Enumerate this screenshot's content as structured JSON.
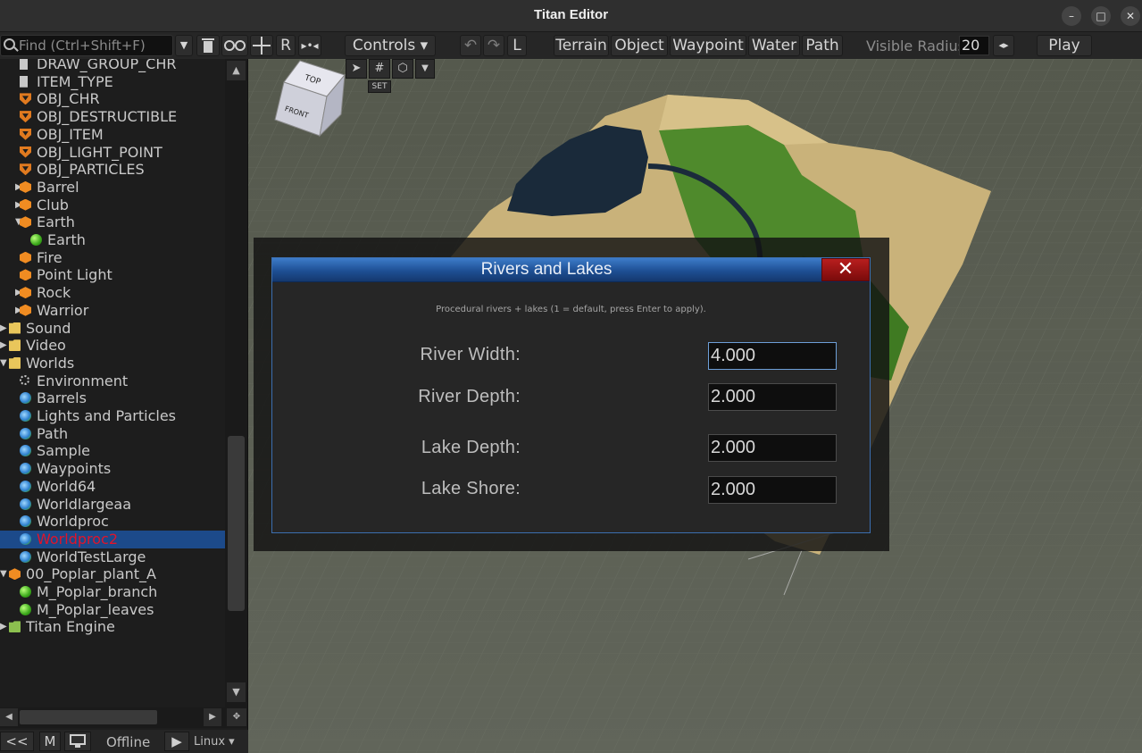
{
  "window": {
    "title": "Titan Editor"
  },
  "window_controls": {
    "minimize": "–",
    "maximize": "□",
    "close": "✕"
  },
  "toolbar": {
    "find_placeholder": "Find (Ctrl+Shift+F)",
    "r_label": "R",
    "controls_label": "Controls ▾",
    "l_label": "L",
    "modes": [
      "Terrain",
      "Object",
      "Waypoint",
      "Water",
      "Path"
    ],
    "visible_radius_label": "Visible Radius",
    "visible_radius_value": "20",
    "play_label": "Play"
  },
  "viewport": {
    "set_label": "SET",
    "view_cube": {
      "top": "TOP",
      "front": "FRONT"
    }
  },
  "tree": {
    "items": [
      {
        "label": "DRAW_GROUP_CHR",
        "icon": "doc-icon",
        "depth": 1,
        "arrow": ""
      },
      {
        "label": "ITEM_TYPE",
        "icon": "doc-icon",
        "depth": 1,
        "arrow": ""
      },
      {
        "label": "OBJ_CHR",
        "icon": "shield-icon",
        "depth": 1,
        "arrow": ""
      },
      {
        "label": "OBJ_DESTRUCTIBLE",
        "icon": "shield-icon",
        "depth": 1,
        "arrow": ""
      },
      {
        "label": "OBJ_ITEM",
        "icon": "shield-icon",
        "depth": 1,
        "arrow": ""
      },
      {
        "label": "OBJ_LIGHT_POINT",
        "icon": "shield-icon",
        "depth": 1,
        "arrow": ""
      },
      {
        "label": "OBJ_PARTICLES",
        "icon": "shield-icon",
        "depth": 1,
        "arrow": ""
      },
      {
        "label": "Barrel",
        "icon": "cube-icon",
        "depth": 1,
        "arrow": "▶"
      },
      {
        "label": "Club",
        "icon": "cube-icon",
        "depth": 1,
        "arrow": "▶"
      },
      {
        "label": "Earth",
        "icon": "cube-icon",
        "depth": 1,
        "arrow": "▼"
      },
      {
        "label": "Earth",
        "icon": "ball-icon",
        "depth": 2,
        "arrow": ""
      },
      {
        "label": "Fire",
        "icon": "cube-icon",
        "depth": 1,
        "arrow": ""
      },
      {
        "label": "Point Light",
        "icon": "cube-icon",
        "depth": 1,
        "arrow": ""
      },
      {
        "label": "Rock",
        "icon": "cube-icon",
        "depth": 1,
        "arrow": "▶"
      },
      {
        "label": "Warrior",
        "icon": "cube-icon",
        "depth": 1,
        "arrow": "▶"
      },
      {
        "label": "Sound",
        "icon": "folder-icon",
        "depth": 0,
        "arrow": "▶"
      },
      {
        "label": "Video",
        "icon": "folder-icon",
        "depth": 0,
        "arrow": "▶"
      },
      {
        "label": "Worlds",
        "icon": "folder-icon",
        "depth": 0,
        "arrow": "▼"
      },
      {
        "label": "Environment",
        "icon": "sun-icon",
        "depth": 1,
        "arrow": ""
      },
      {
        "label": "Barrels",
        "icon": "globe-icon",
        "depth": 1,
        "arrow": ""
      },
      {
        "label": "Lights and Particles",
        "icon": "globe-icon",
        "depth": 1,
        "arrow": ""
      },
      {
        "label": "Path",
        "icon": "globe-icon",
        "depth": 1,
        "arrow": ""
      },
      {
        "label": "Sample",
        "icon": "globe-icon",
        "depth": 1,
        "arrow": ""
      },
      {
        "label": "Waypoints",
        "icon": "globe-icon",
        "depth": 1,
        "arrow": ""
      },
      {
        "label": "World64",
        "icon": "globe-icon",
        "depth": 1,
        "arrow": ""
      },
      {
        "label": "Worldlargeaa",
        "icon": "globe-icon",
        "depth": 1,
        "arrow": ""
      },
      {
        "label": "Worldproc",
        "icon": "globe-icon",
        "depth": 1,
        "arrow": ""
      },
      {
        "label": "Worldproc2",
        "icon": "globe-icon",
        "depth": 1,
        "arrow": "",
        "selected": true
      },
      {
        "label": "WorldTestLarge",
        "icon": "globe-icon",
        "depth": 1,
        "arrow": ""
      },
      {
        "label": "00_Poplar_plant_A",
        "icon": "cube-icon",
        "depth": 0,
        "arrow": "▼"
      },
      {
        "label": "M_Poplar_branch",
        "icon": "ball-icon",
        "depth": 1,
        "arrow": ""
      },
      {
        "label": "M_Poplar_leaves",
        "icon": "ball-icon",
        "depth": 1,
        "arrow": ""
      },
      {
        "label": "Titan Engine",
        "icon": "folder-green-icon",
        "depth": 0,
        "arrow": "▶"
      }
    ]
  },
  "statusbar": {
    "back_label": "<<",
    "m_label": "M",
    "status_text": "Offline",
    "platform": "Linux ▾"
  },
  "dialog": {
    "title": "Rivers and Lakes",
    "close_label": "✕",
    "hint": "Procedural rivers + lakes (1 = default, press Enter to apply).",
    "fields": [
      {
        "label": "River Width:",
        "value": "4.000"
      },
      {
        "label": "River Depth:",
        "value": "2.000"
      },
      {
        "label": "Lake Depth:",
        "value": "2.000"
      },
      {
        "label": "Lake Shore:",
        "value": "2.000"
      }
    ]
  },
  "colors": {
    "selection": "#1c4a8a",
    "selected_text": "#e0142a",
    "dialog_title": "#1e4f94",
    "close_button": "#9b1414",
    "sand": "#c9b27a",
    "grass": "#4f8a2c",
    "water": "#1a2a3a"
  }
}
